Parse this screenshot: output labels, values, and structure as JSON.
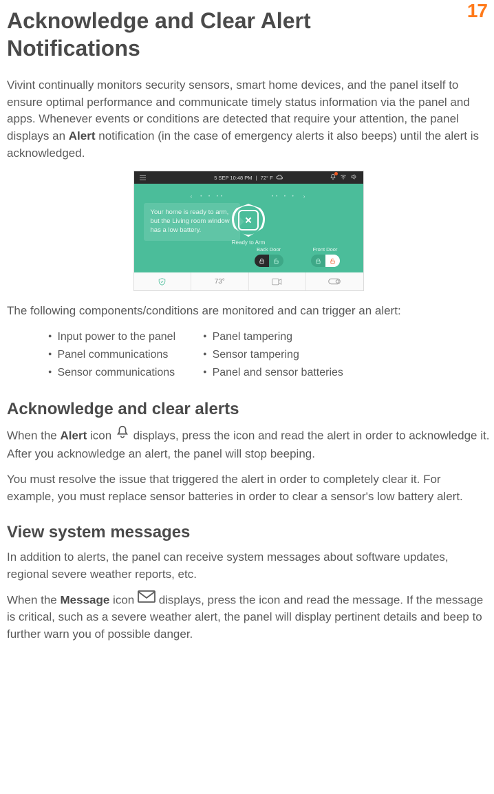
{
  "page_number": "17",
  "title": "Acknowledge and Clear Alert Notifications",
  "intro": {
    "part1": "Vivint continually monitors security sensors, smart home devices, and the panel itself to ensure optimal performance and communicate timely status information via the panel and apps. Whenever events or conditions are detected that require your attention, the panel displays an ",
    "bold": "Alert",
    "part2": " notification (in the case of emergency alerts it also beeps) until the alert is acknowledged."
  },
  "panel": {
    "datetime": "5 SEP 10:48 PM",
    "temp": "72° F",
    "message": "Your home is ready to arm, but the Living room window has a low battery.",
    "status": "Ready to Arm",
    "doors": {
      "back": "Back Door",
      "front": "Front Door"
    },
    "footer_temp": "73°"
  },
  "triggers_lead": "The following components/conditions are monitored and can trigger an alert:",
  "triggers_col1": [
    "Input power to the panel",
    "Panel communications",
    "Sensor communications"
  ],
  "triggers_col2": [
    "Panel tampering",
    "Sensor tampering",
    "Panel and sensor batteries"
  ],
  "section1": {
    "heading": "Acknowledge and clear alerts",
    "p1_a": "When the ",
    "p1_bold": "Alert",
    "p1_b": " icon ",
    "p1_c": " displays, press the icon and read the alert in order to acknowledge it. After you acknowledge an alert, the panel will stop beeping.",
    "p2": "You must resolve the issue that triggered the alert in order to completely clear it. For example, you must replace sensor batteries in order to clear a sensor's low battery alert."
  },
  "section2": {
    "heading": "View system messages",
    "p1": "In addition to alerts, the panel can receive system messages about software updates, regional severe weather reports, etc.",
    "p2_a": "When the ",
    "p2_bold": "Message",
    "p2_b": " icon ",
    "p2_c": " displays, press the icon and read the message. If the message is critical, such as a severe weather alert, the panel will display pertinent details and beep to further warn you of possible danger."
  }
}
